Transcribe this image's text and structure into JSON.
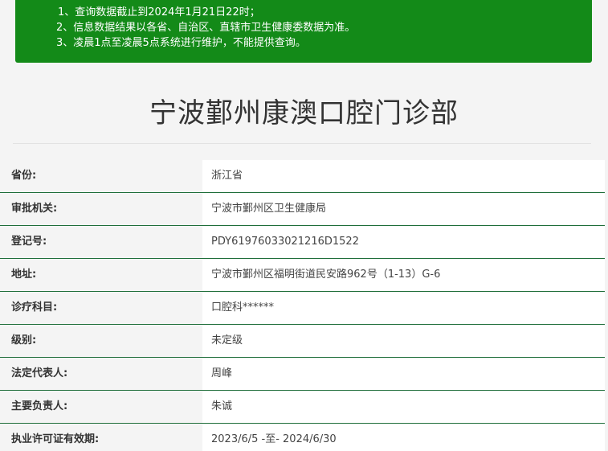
{
  "notice": {
    "lines": [
      "1、查询数据截止到2024年1月21日22时；",
      "2、信息数据结果以各省、自治区、直辖市卫生健康委数据为准。",
      "3、凌晨1点至凌晨5点系统进行维护，不能提供查询。"
    ],
    "background_color": "#138a18"
  },
  "clinic": {
    "name": "宁波鄞州康澳口腔门诊部"
  },
  "info": [
    {
      "label": "省份:",
      "value": "浙江省"
    },
    {
      "label": "审批机关:",
      "value": "宁波市鄞州区卫生健康局"
    },
    {
      "label": "登记号:",
      "value": "PDY61976033021216D1522"
    },
    {
      "label": "地址:",
      "value": "宁波市鄞州区福明街道民安路962号（1-13）G-6"
    },
    {
      "label": "诊疗科目:",
      "value": "口腔科******"
    },
    {
      "label": "级别:",
      "value": "未定级"
    },
    {
      "label": "法定代表人:",
      "value": "周峰"
    },
    {
      "label": "主要负责人:",
      "value": "朱诚"
    },
    {
      "label": "执业许可证有效期:",
      "value": "2023/6/5 -至- 2024/6/30"
    }
  ],
  "colors": {
    "row_divider": "#1f6e3a",
    "page_background": "#f4f4f4"
  }
}
